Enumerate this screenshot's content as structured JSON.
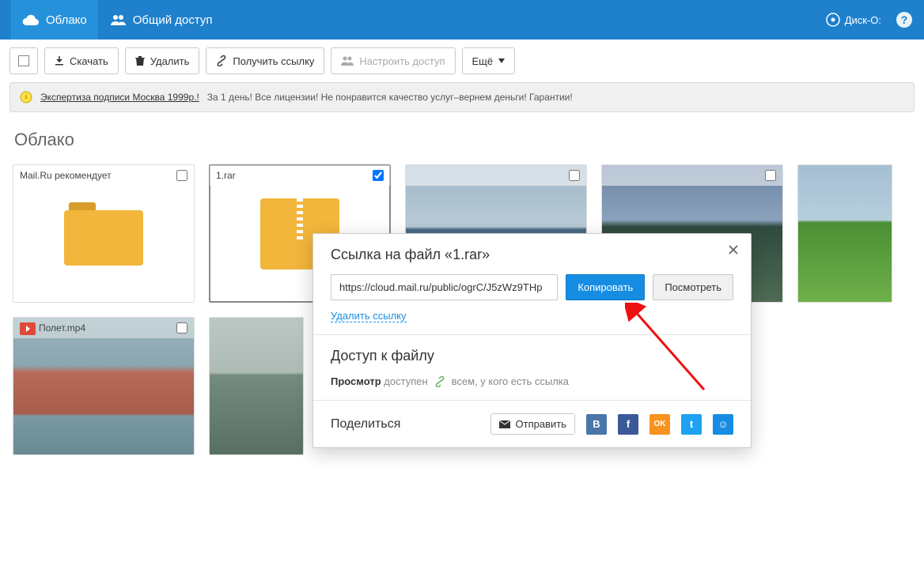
{
  "header": {
    "tab_cloud": "Облако",
    "tab_shared": "Общий доступ",
    "disk_o": "Диск-О:"
  },
  "toolbar": {
    "download": "Скачать",
    "delete": "Удалить",
    "get_link": "Получить ссылку",
    "configure_access": "Настроить доступ",
    "more": "Ещё"
  },
  "ad": {
    "link": "Экспертиза подписи Москва 1999р.!",
    "text": "За 1 день! Все лицензии! Не понравится качество услуг–вернем деньги! Гарантии!"
  },
  "page": {
    "title": "Облако"
  },
  "tiles": [
    {
      "name": "Mail.Ru рекомендует",
      "checked": false,
      "type": "folder"
    },
    {
      "name": "1.rar",
      "checked": true,
      "type": "archive"
    },
    {
      "name": "",
      "checked": false,
      "type": "image"
    },
    {
      "name": "",
      "checked": false,
      "type": "image"
    },
    {
      "name": "",
      "checked": false,
      "type": "image"
    },
    {
      "name": "Полет.mp4",
      "checked": false,
      "type": "video"
    },
    {
      "name": "",
      "checked": false,
      "type": "image"
    }
  ],
  "modal": {
    "title": "Ссылка на файл «1.rar»",
    "link_value": "https://cloud.mail.ru/public/ogrC/J5zWz9THp",
    "copy": "Копировать",
    "view": "Посмотреть",
    "delete_link": "Удалить ссылку",
    "access_heading": "Доступ к файлу",
    "access_label_strong": "Просмотр",
    "access_label_rest": "доступен",
    "access_value": "всем, у кого есть ссылка",
    "share_heading": "Поделиться",
    "send": "Отправить"
  },
  "social": {
    "vk": "В",
    "fb": "f",
    "ok": "OK",
    "tw": "t",
    "mm": "☺"
  }
}
